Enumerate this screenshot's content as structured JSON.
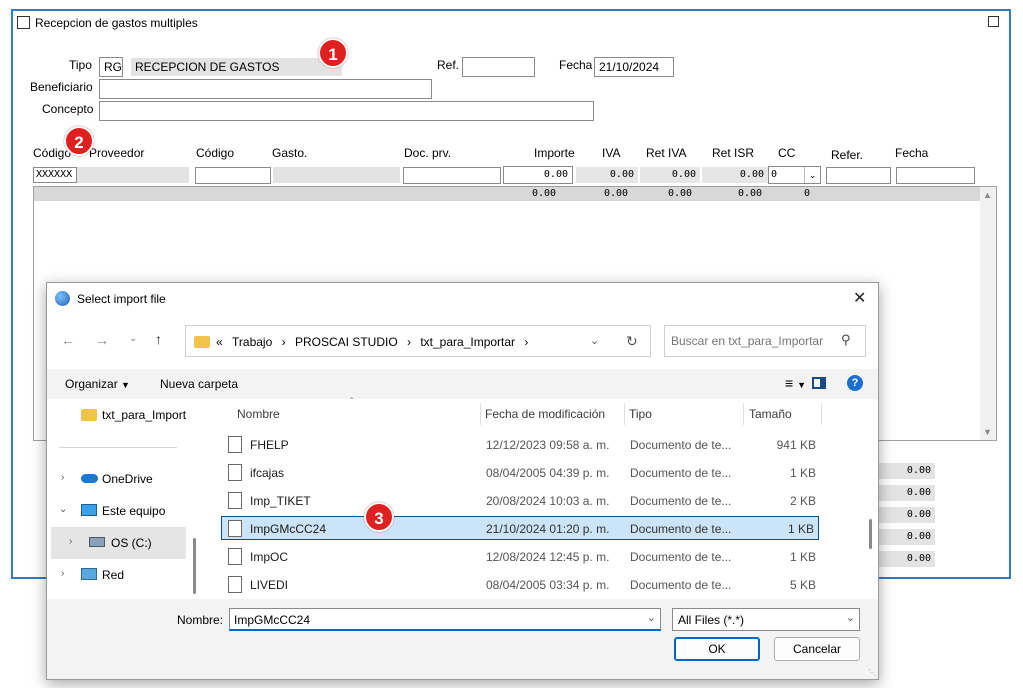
{
  "main": {
    "title": "Recepcion de gastos multiples",
    "labels": {
      "tipo": "Tipo",
      "ref": "Ref.",
      "fecha": "Fecha",
      "beneficiario": "Beneficiario",
      "concepto": "Concepto"
    },
    "tipo_code": "RG",
    "tipo_desc": "RECEPCION DE GASTOS",
    "ref_value": "",
    "fecha_value": "21/10/2024",
    "beneficiario_value": "",
    "concepto_value": "",
    "columns": [
      "Código",
      "Proveedor",
      "Código",
      "Gasto.",
      "Doc. prv.",
      "Importe",
      "IVA",
      "Ret IVA",
      "Ret ISR",
      "CC",
      "Refer.",
      "Fecha"
    ],
    "entry_row": {
      "codigo": "XXXXXX",
      "importe": "0.00",
      "iva": "0.00",
      "ret_iva": "0.00",
      "ret_isr": "0.00",
      "cc": "0"
    },
    "totals_row": {
      "importe": "0.00",
      "iva": "0.00",
      "ret_iva": "0.00",
      "ret_isr": "0.00",
      "cc": "0"
    },
    "summary_values": [
      "0.00",
      "0.00",
      "0.00",
      "0.00",
      "0.00"
    ]
  },
  "badges": [
    "1",
    "2",
    "3"
  ],
  "dialog": {
    "title": "Select import file",
    "breadcrumb": [
      "«",
      "Trabajo",
      "PROSCAI STUDIO",
      "txt_para_Importar"
    ],
    "search_placeholder": "Buscar en txt_para_Importar",
    "toolbar": {
      "organize": "Organizar",
      "new_folder": "Nueva carpeta"
    },
    "nav": [
      {
        "label": "txt_para_Import",
        "icon": "folder-icon"
      },
      {
        "label": "OneDrive",
        "icon": "cloud-icon"
      },
      {
        "label": "Este equipo",
        "icon": "computer-icon"
      },
      {
        "label": "OS (C:)",
        "icon": "drive-icon"
      },
      {
        "label": "Red",
        "icon": "network-icon"
      }
    ],
    "columns": [
      "Nombre",
      "Fecha de modificación",
      "Tipo",
      "Tamaño"
    ],
    "files": [
      {
        "name": "FHELP",
        "date": "12/12/2023 09:58 a. m.",
        "type": "Documento de te...",
        "size": "941 KB"
      },
      {
        "name": "ifcajas",
        "date": "08/04/2005 04:39 p. m.",
        "type": "Documento de te...",
        "size": "1 KB"
      },
      {
        "name": "Imp_TIKET",
        "date": "20/08/2024 10:03 a. m.",
        "type": "Documento de te...",
        "size": "2 KB"
      },
      {
        "name": "ImpGMcCC24",
        "date": "21/10/2024 01:20 p. m.",
        "type": "Documento de te...",
        "size": "1 KB"
      },
      {
        "name": "ImpOC",
        "date": "12/08/2024 12:45 p. m.",
        "type": "Documento de te...",
        "size": "1 KB"
      },
      {
        "name": "LIVEDI",
        "date": "08/04/2005 03:34 p. m.",
        "type": "Documento de te...",
        "size": "5 KB"
      }
    ],
    "filename_label": "Nombre:",
    "filename_value": "ImpGMcCC24",
    "filter_value": "All Files (*.*)",
    "ok_label": "OK",
    "cancel_label": "Cancelar"
  }
}
